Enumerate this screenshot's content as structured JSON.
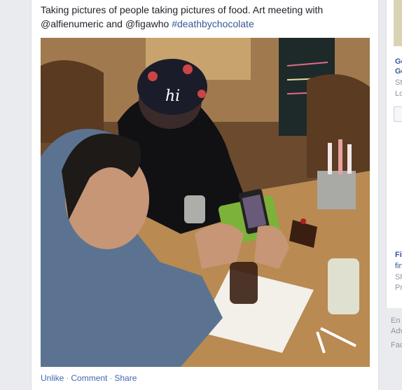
{
  "post": {
    "text_main": "Taking pictures of people taking pictures of food. Art meeting with @alfienumeric and @figawho ",
    "hashtag": "#deathbychocolate",
    "photo": {
      "cap_text": "hi",
      "cap_color": "#1a1c2a"
    },
    "actions": {
      "unlike": "Unlike",
      "comment": "Comment",
      "share": "Share",
      "separator": "·"
    }
  },
  "right_sidebar": {
    "suggestion_1": {
      "title_a": "Go",
      "title_b": "Go",
      "sub_a": "Sta",
      "sub_b": "Lo"
    },
    "suggestion_2": {
      "title": "Fi",
      "sub_a": "fin",
      "sub_b": "Sh",
      "sub_c": "Pr"
    },
    "footer": {
      "line_1": "En",
      "line_2": "Adv",
      "line_3": "Fac"
    }
  }
}
